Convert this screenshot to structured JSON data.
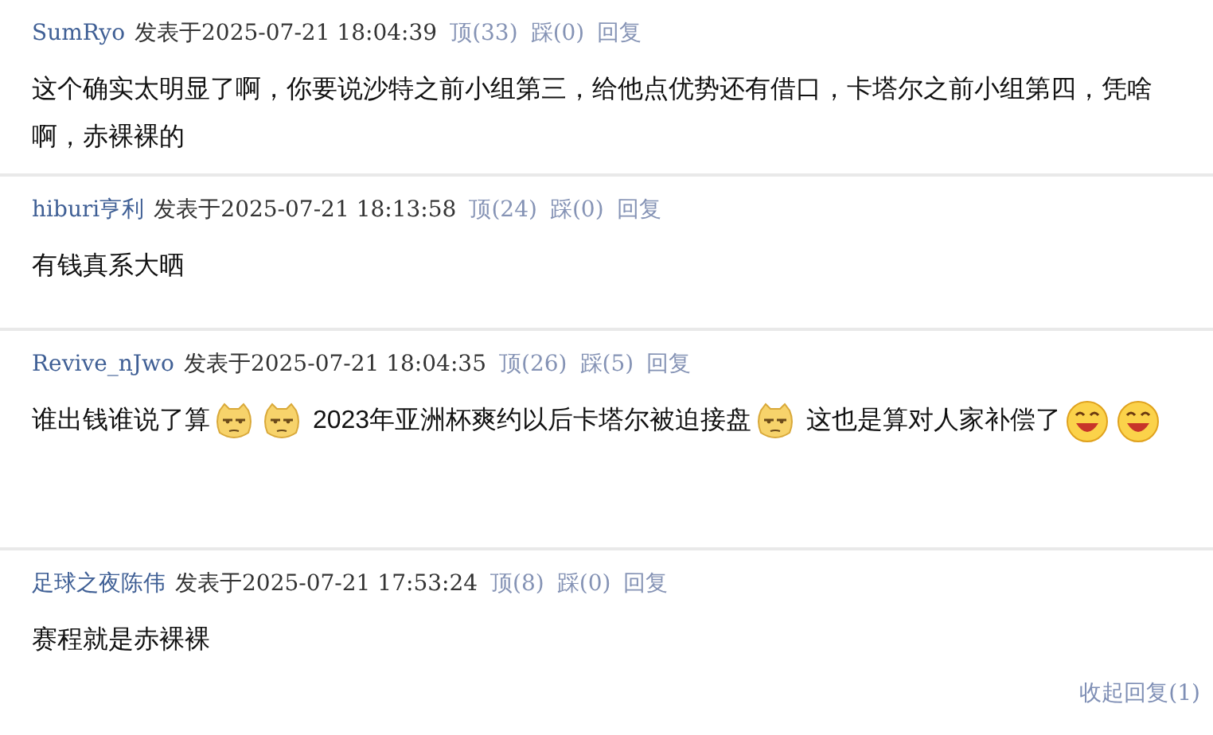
{
  "comments": [
    {
      "user": "SumRyo",
      "posted": "发表于2025-07-21 18:04:39",
      "up": "顶(33)",
      "down": "踩(0)",
      "reply": "回复",
      "body": [
        {
          "kind": "text",
          "text": "这个确实太明显了啊，你要说沙特之前小组第三，给他点优势还有借口，卡塔尔之前小组第四，凭啥啊，赤裸裸的"
        }
      ]
    },
    {
      "user": "hiburi亨利",
      "posted": "发表于2025-07-21 18:13:58",
      "up": "顶(24)",
      "down": "踩(0)",
      "reply": "回复",
      "body": [
        {
          "kind": "text",
          "text": "有钱真系大晒"
        }
      ]
    },
    {
      "user": "Revive_nJwo",
      "posted": "发表于2025-07-21 18:04:35",
      "up": "顶(26)",
      "down": "踩(5)",
      "reply": "回复",
      "body": [
        {
          "kind": "text",
          "text": "谁出钱谁说了算"
        },
        {
          "kind": "sly"
        },
        {
          "kind": "sly"
        },
        {
          "kind": "text",
          "text": " 2023年亚洲杯爽约以后卡塔尔被迫接盘"
        },
        {
          "kind": "sly"
        },
        {
          "kind": "text",
          "text": " 这也是算对人家补偿了"
        },
        {
          "kind": "grin"
        },
        {
          "kind": "grin"
        }
      ]
    },
    {
      "user": "足球之夜陈伟",
      "posted": "发表于2025-07-21 17:53:24",
      "up": "顶(8)",
      "down": "踩(0)",
      "reply": "回复",
      "body": [
        {
          "kind": "text",
          "text": "赛程就是赤裸裸"
        }
      ]
    }
  ],
  "collapse": "收起回复(1)"
}
